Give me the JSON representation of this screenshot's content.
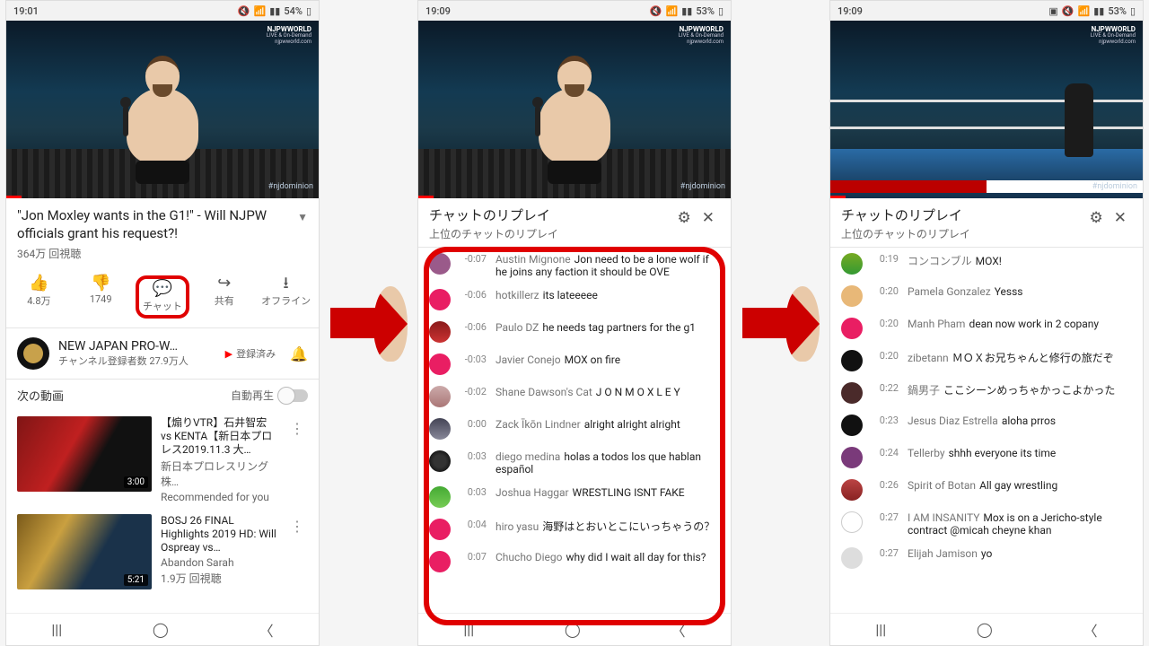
{
  "panel1": {
    "status": {
      "time": "19:01",
      "battery": "54%"
    },
    "video": {
      "logo_top": "NJPWWORLD",
      "logo_sub1": "LIVE & On-Demand",
      "logo_sub2": "njpwworld.com",
      "hashtag": "#njdominion"
    },
    "title": "\"Jon Moxley wants in the G1!\" - Will NJPW officials grant his request?!",
    "views": "364万 回視聴",
    "actions": {
      "like": "4.8万",
      "dislike": "1749",
      "chat": "チャット",
      "share": "共有",
      "offline": "オフライン"
    },
    "channel": {
      "name": "NEW JAPAN PRO-W…",
      "subs": "チャンネル登録者数 27.9万人",
      "subscribed": "登録済み"
    },
    "next": {
      "label": "次の動画",
      "autoplay": "自動再生"
    },
    "videos": [
      {
        "title": "【煽りVTR】石井智宏 vs KENTA【新日本プロレス2019.11.3 大…",
        "sub1": "新日本プロレスリング株…",
        "sub2": "Recommended for you",
        "dur": "3:00"
      },
      {
        "title": "BOSJ 26 FINAL Highlights 2019 HD: Will Ospreay vs…",
        "sub1": "Abandon Sarah",
        "sub2": "1.9万 回視聴",
        "dur": "5:21"
      }
    ]
  },
  "panel2": {
    "status": {
      "time": "19:09",
      "battery": "53%"
    },
    "chat": {
      "title": "チャットのリプレイ",
      "subtitle": "上位のチャットのリプレイ"
    },
    "messages": [
      {
        "t": "-0:07",
        "u": "Austin Mignone",
        "m": "Jon need to be a lone wolf if he joins any faction it should be OVE"
      },
      {
        "t": "-0:06",
        "u": "hotkillerz",
        "m": "its lateeeee"
      },
      {
        "t": "-0:06",
        "u": "Paulo DZ",
        "m": "he needs tag partners for the g1"
      },
      {
        "t": "-0:03",
        "u": "Javier Conejo",
        "m": "MOX on fire"
      },
      {
        "t": "-0:02",
        "u": "Shane Dawson's Cat",
        "m": "J O N M O X L E Y"
      },
      {
        "t": "0:00",
        "u": "Zack Īkōn Lindner",
        "m": "alright alright alright"
      },
      {
        "t": "0:03",
        "u": "diego medina",
        "m": "holas a todos los que hablan español"
      },
      {
        "t": "0:03",
        "u": "Joshua Haggar",
        "m": "WRESTLING ISNT FAKE"
      },
      {
        "t": "0:04",
        "u": "hiro yasu",
        "m": "海野はとおいとこにいっちゃうの？"
      },
      {
        "t": "0:07",
        "u": "Chucho Diego",
        "m": "why did I wait all day for this?"
      }
    ]
  },
  "panel3": {
    "status": {
      "time": "19:09",
      "battery": "53%"
    },
    "chat": {
      "title": "チャットのリプレイ",
      "subtitle": "上位のチャットのリプレイ"
    },
    "messages": [
      {
        "t": "0:19",
        "u": "コンコンブル",
        "m": "MOX!"
      },
      {
        "t": "0:20",
        "u": "Pamela Gonzalez",
        "m": "Yesss"
      },
      {
        "t": "0:20",
        "u": "Manh Pham",
        "m": "dean now work in 2 copany"
      },
      {
        "t": "0:20",
        "u": "zibetann",
        "m": "ＭＯＸお兄ちゃんと修行の旅だぞ"
      },
      {
        "t": "0:22",
        "u": "鍋男子",
        "m": "ここシーンめっちゃかっこよかった"
      },
      {
        "t": "0:23",
        "u": "Jesus Diaz Estrella",
        "m": "aloha prros"
      },
      {
        "t": "0:24",
        "u": "Tellerby",
        "m": "shhh everyone its time"
      },
      {
        "t": "0:26",
        "u": "Spirit of Botan",
        "m": "All gay wrestling"
      },
      {
        "t": "0:27",
        "u": "I AM INSANITY",
        "m": "Mox is on a Jericho-style contract @micah cheyne khan"
      },
      {
        "t": "0:27",
        "u": "Elijah Jamison",
        "m": "yo"
      }
    ]
  }
}
